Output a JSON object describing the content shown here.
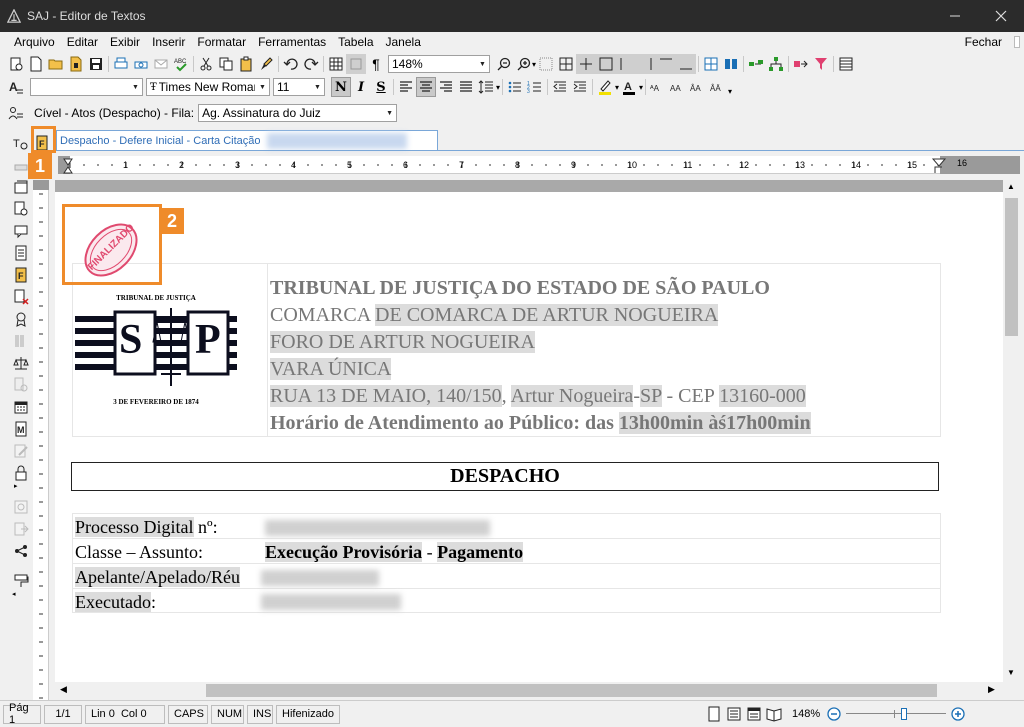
{
  "window": {
    "title": "SAJ - Editor de Textos",
    "min_icon": "minimize-icon",
    "close_icon": "close-icon"
  },
  "menu": {
    "items": [
      "Arquivo",
      "Editar",
      "Exibir",
      "Inserir",
      "Formatar",
      "Ferramentas",
      "Tabela",
      "Janela"
    ],
    "fechar": "Fechar"
  },
  "toolbar1": {
    "zoom": "148%"
  },
  "toolbar2": {
    "font_name": "Times New Roman",
    "font_size": "11",
    "bold": "N",
    "italic": "I",
    "underline": "S"
  },
  "queue": {
    "label": "Cível - Atos (Despacho) - Fila:",
    "value": "Ag. Assinatura do Juiz"
  },
  "tab": {
    "label": "Despacho - Defere Inicial - Carta Citação"
  },
  "annotations": {
    "marker1": "1",
    "marker2": "2"
  },
  "stamp": {
    "text": "FINALIZADO"
  },
  "logo": {
    "top": "TRIBUNAL DE JUSTIÇA",
    "left_letter": "S",
    "right_letter": "P",
    "bottom": "3 DE FEVEREIRO DE 1874"
  },
  "letterhead": {
    "line1": "TRIBUNAL DE JUSTIÇA DO ESTADO DE SÃO PAULO",
    "line2a": "COMARCA ",
    "line2b": "DE COMARCA DE ARTUR NOGUEIRA",
    "line3": "FORO DE ARTUR NOGUEIRA",
    "line4": "VARA ÚNICA",
    "line5a": "RUA 13 DE MAIO, 140/150",
    "line5b": ", ",
    "line5c": "Artur Nogueira",
    "line5d": "-",
    "line5e": "SP",
    "line5f": " - CEP ",
    "line5g": "13160-000",
    "line6a": "Horário de Atendimento ao Público: das ",
    "line6b": "13h00min àś17h00min"
  },
  "document": {
    "heading": "DESPACHO"
  },
  "fields": {
    "processo_label": "Processo Digital",
    "processo_suffix": " nº:",
    "classe_label": "Classe – Assunto:",
    "classe_value": "Execução Provisória",
    "classe_sep": " - ",
    "classe_value2": "Pagamento",
    "apelante_label": "Apelante/Apelado/Réu",
    "executado_label": "Executado",
    "executado_suffix": ":"
  },
  "status": {
    "page": "Pág 1",
    "pages": "1/1",
    "linecol": "Lin 0  Col 0",
    "caps": "CAPS",
    "num": "NUM",
    "ins": "INS",
    "hyph": "Hifenizado",
    "zoom": "148%"
  }
}
